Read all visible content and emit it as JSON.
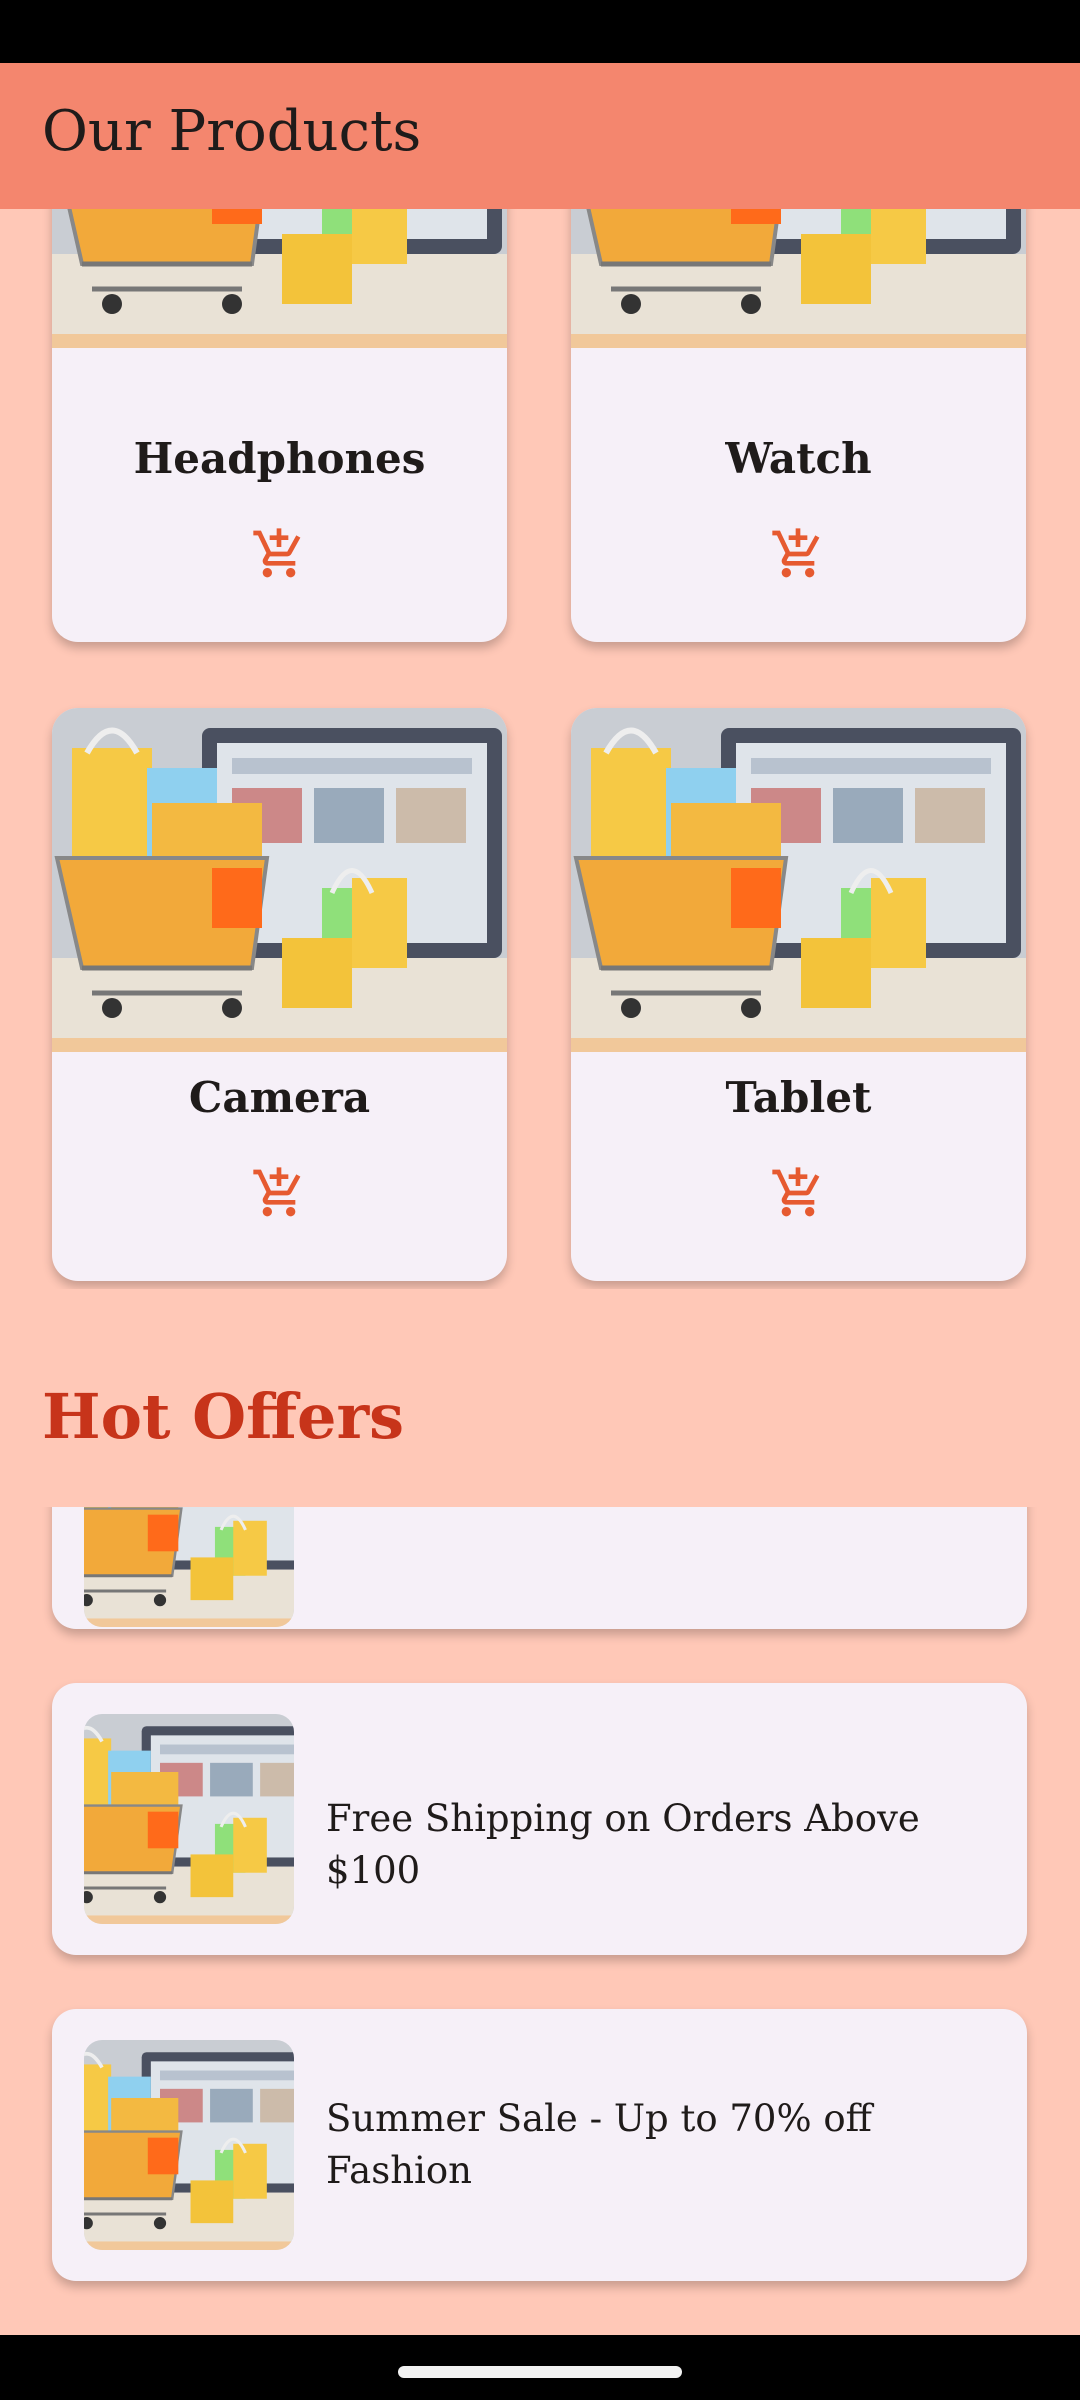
{
  "app_bar": {
    "title": "Our Products"
  },
  "products": [
    {
      "name": "Headphones",
      "cart_icon": "add-shopping-cart-icon"
    },
    {
      "name": "Watch",
      "cart_icon": "add-shopping-cart-icon"
    },
    {
      "name": "Camera",
      "cart_icon": "add-shopping-cart-icon"
    },
    {
      "name": "Tablet",
      "cart_icon": "add-shopping-cart-icon"
    }
  ],
  "hot_offers": {
    "title": "Hot Offers",
    "items": [
      {
        "text": ""
      },
      {
        "text": "Free Shipping on Orders Above $100"
      },
      {
        "text": "Summer Sale - Up to 70% off Fashion"
      }
    ]
  },
  "colors": {
    "app_bar": "#f4866e",
    "background": "#ffc8b7",
    "card": "#f6f0f8",
    "accent": "#e65a30",
    "section_title": "#c7341a"
  }
}
